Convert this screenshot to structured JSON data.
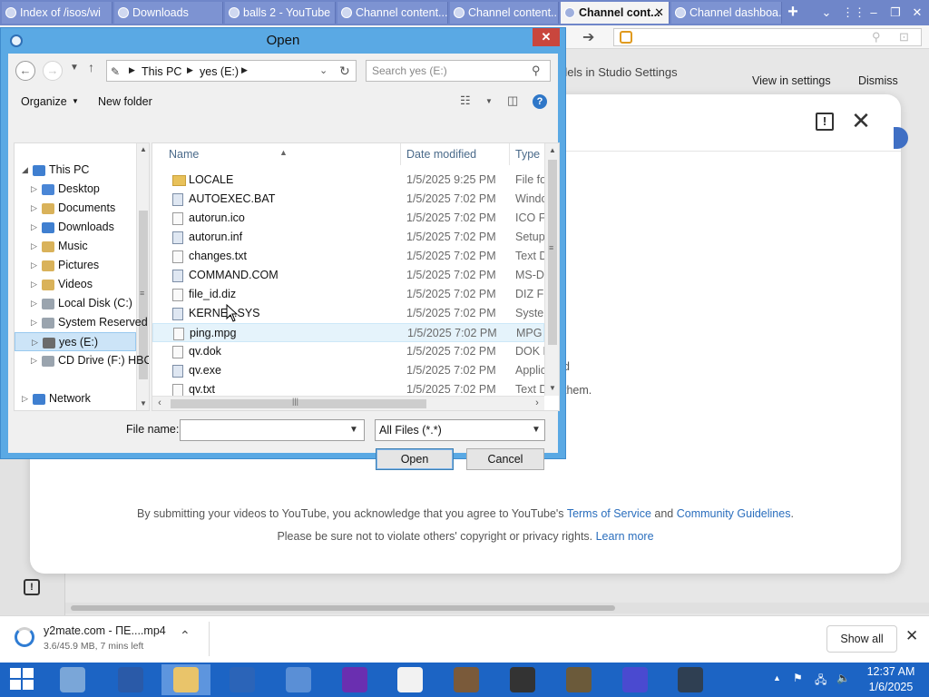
{
  "browser": {
    "tabs": [
      {
        "title": "Index of /isos/wi",
        "active": false
      },
      {
        "title": "Downloads",
        "active": false
      },
      {
        "title": "balls 2 - YouTube",
        "active": false
      },
      {
        "title": "Channel content...",
        "active": false
      },
      {
        "title": "Channel content...",
        "active": false
      },
      {
        "title": "Channel cont...",
        "active": true
      },
      {
        "title": "Channel dashboa...",
        "active": false
      }
    ]
  },
  "page": {
    "banner_text": "dels in Studio Settings",
    "banner_view": "View in settings",
    "banner_dismiss": "Dismiss",
    "body_fragment": "them.",
    "legal_line1_prefix": "By submitting your videos to YouTube, you acknowledge that you agree to YouTube's ",
    "legal_tos": "Terms of Service",
    "legal_and": " and ",
    "legal_guidelines": "Community Guidelines",
    "legal_period": ".",
    "legal_line2_prefix": "Please be sure not to violate others' copyright or privacy rights. ",
    "legal_learn_more": "Learn more"
  },
  "dialog": {
    "title": "Open",
    "close": "✕",
    "breadcrumb": [
      "This PC",
      "yes (E:)"
    ],
    "search_placeholder": "Search yes (E:)",
    "organize": "Organize",
    "new_folder": "New folder",
    "help": "?",
    "nav_items": [
      {
        "label": "This PC",
        "level": 0,
        "expanded": true,
        "icon_color": "#3f7fd0"
      },
      {
        "label": "Desktop",
        "level": 1,
        "icon_color": "#4a86d6"
      },
      {
        "label": "Documents",
        "level": 1,
        "icon_color": "#d9b25a"
      },
      {
        "label": "Downloads",
        "level": 1,
        "icon_color": "#3f7fd0"
      },
      {
        "label": "Music",
        "level": 1,
        "icon_color": "#d9b25a"
      },
      {
        "label": "Pictures",
        "level": 1,
        "icon_color": "#d9b25a"
      },
      {
        "label": "Videos",
        "level": 1,
        "icon_color": "#d9b25a"
      },
      {
        "label": "Local Disk (C:)",
        "level": 1,
        "icon_color": "#9aa4ae"
      },
      {
        "label": "System Reserved",
        "level": 1,
        "icon_color": "#9aa4ae"
      },
      {
        "label": "yes (E:)",
        "level": 1,
        "selected": true,
        "icon_color": "#6b6b6b"
      },
      {
        "label": "CD Drive (F:) HBC",
        "level": 1,
        "icon_color": "#9aa4ae"
      },
      {
        "label": "Network",
        "level": 0,
        "icon_color": "#3f7fd0",
        "gap": true
      }
    ],
    "columns": {
      "name": "Name",
      "date": "Date modified",
      "type": "Type"
    },
    "files": [
      {
        "name": "LOCALE",
        "date": "1/5/2025 9:25 PM",
        "type": "File fol",
        "icon": "folder"
      },
      {
        "name": "AUTOEXEC.BAT",
        "date": "1/5/2025 7:02 PM",
        "type": "Windo",
        "icon": "app"
      },
      {
        "name": "autorun.ico",
        "date": "1/5/2025 7:02 PM",
        "type": "ICO Fil",
        "icon": "file"
      },
      {
        "name": "autorun.inf",
        "date": "1/5/2025 7:02 PM",
        "type": "Setup",
        "icon": "app"
      },
      {
        "name": "changes.txt",
        "date": "1/5/2025 7:02 PM",
        "type": "Text D",
        "icon": "file"
      },
      {
        "name": "COMMAND.COM",
        "date": "1/5/2025 7:02 PM",
        "type": "MS-DO",
        "icon": "app"
      },
      {
        "name": "file_id.diz",
        "date": "1/5/2025 7:02 PM",
        "type": "DIZ Fil",
        "icon": "file"
      },
      {
        "name": "KERNEL.SYS",
        "date": "1/5/2025 7:02 PM",
        "type": "System",
        "icon": "app"
      },
      {
        "name": "ping.mpg",
        "date": "1/5/2025 7:02 PM",
        "type": "MPG F",
        "icon": "file",
        "hover": true
      },
      {
        "name": "qv.dok",
        "date": "1/5/2025 7:02 PM",
        "type": "DOK F",
        "icon": "file"
      },
      {
        "name": "qv.exe",
        "date": "1/5/2025 7:02 PM",
        "type": "Applic",
        "icon": "app"
      },
      {
        "name": "qv.txt",
        "date": "1/5/2025 7:02 PM",
        "type": "Text D",
        "icon": "file"
      }
    ],
    "file_name_label": "File name:",
    "file_name_value": "",
    "file_type": "All Files (*.*)",
    "open_button": "Open",
    "cancel_button": "Cancel"
  },
  "downloads": {
    "file": "y2mate.com - ПЕ....mp4",
    "status": "3.6/45.9 MB, 7 mins left",
    "show_all": "Show all"
  },
  "taskbar": {
    "apps": [
      {
        "name": "server-manager",
        "color": "#7aa6d8"
      },
      {
        "name": "powershell",
        "color": "#2a5aa8"
      },
      {
        "name": "file-explorer",
        "color": "#e9c46a",
        "active": true
      },
      {
        "name": "app-a",
        "color": "#2b64b8"
      },
      {
        "name": "browser",
        "color": "#5a8fd6"
      },
      {
        "name": "yahoo",
        "color": "#6a2fb0"
      },
      {
        "name": "blank-doc",
        "color": "#f2f2f2"
      },
      {
        "name": "minecraft",
        "color": "#7a5a3a"
      },
      {
        "name": "media-app",
        "color": "#333333"
      },
      {
        "name": "gimp",
        "color": "#6b5a3a"
      },
      {
        "name": "virus-app",
        "color": "#4a4ad0"
      },
      {
        "name": "monitor-app",
        "color": "#2f3f52"
      }
    ],
    "time": "12:37 AM",
    "date": "1/6/2025"
  }
}
